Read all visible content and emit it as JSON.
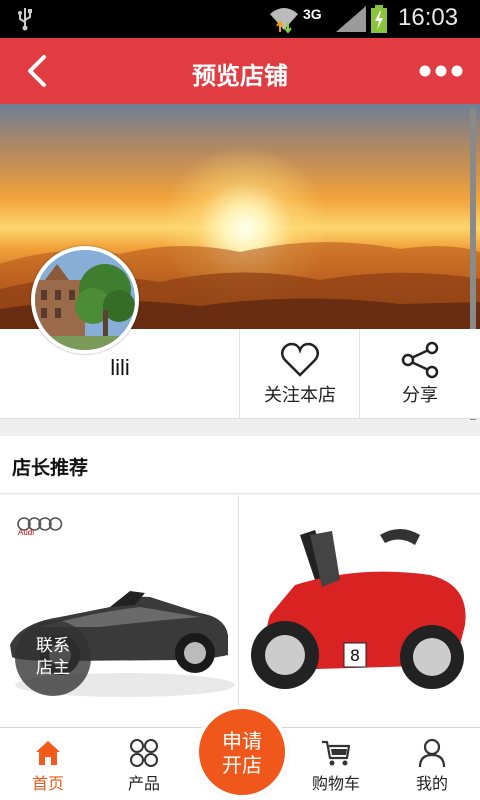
{
  "status_bar": {
    "network": "3G",
    "time": "16:03"
  },
  "header": {
    "title": "预览店铺"
  },
  "shop": {
    "name": "lili",
    "follow_label": "关注本店",
    "share_label": "分享"
  },
  "section": {
    "title": "店长推荐"
  },
  "products": [
    {
      "brand_text": "Audi"
    },
    {
      "badge_number": "8"
    }
  ],
  "contact_button": {
    "line1": "联系",
    "line2": "店主"
  },
  "bottom_nav": {
    "items": [
      {
        "label": "首页",
        "active": true
      },
      {
        "label": "产品",
        "active": false
      },
      {
        "label": "购物车",
        "active": false
      },
      {
        "label": "我的",
        "active": false
      }
    ],
    "center": {
      "line1": "申请",
      "line2": "开店"
    }
  },
  "colors": {
    "header_bg": "#e23c43",
    "accent": "#f0581b",
    "active_nav": "#f05a1a"
  }
}
